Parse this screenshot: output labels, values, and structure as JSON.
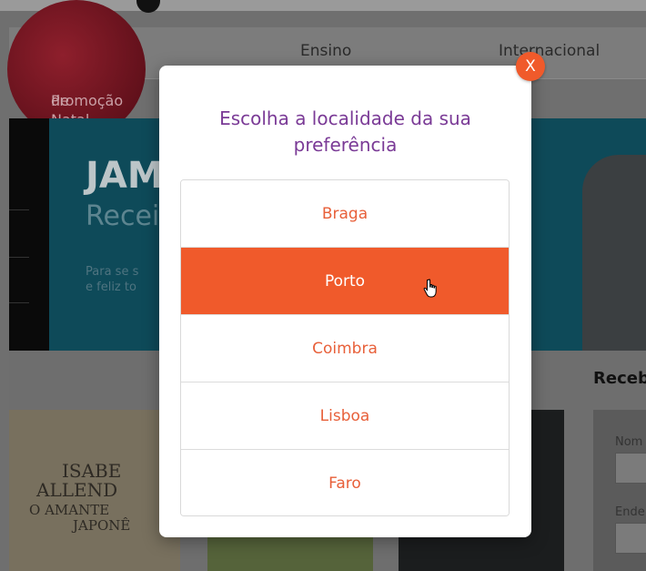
{
  "nav": {
    "promo_line1": "Promoção",
    "promo_line2": "de Natal",
    "ensino": "Ensino",
    "internacional": "Internacional"
  },
  "hero": {
    "title": "JAM",
    "subtitle": "Recei",
    "text_line1": "Para se s",
    "text_line2": "e feliz to"
  },
  "sidebar": {
    "heading": "Receb",
    "name_label": "Nom",
    "email_label": "Ende"
  },
  "books": {
    "author1": "ISABE",
    "author2": "ALLEND",
    "title1": "O AMANTE",
    "title2": "JAPONÊ"
  },
  "modal": {
    "title": "Escolha a localidade da sua preferência",
    "close_label": "X",
    "options": [
      {
        "label": "Braga",
        "active": false
      },
      {
        "label": "Porto",
        "active": true
      },
      {
        "label": "Coimbra",
        "active": false
      },
      {
        "label": "Lisboa",
        "active": false
      },
      {
        "label": "Faro",
        "active": false
      }
    ]
  },
  "colors": {
    "accent": "#f05a2b",
    "title_purple": "#7a3a96"
  }
}
